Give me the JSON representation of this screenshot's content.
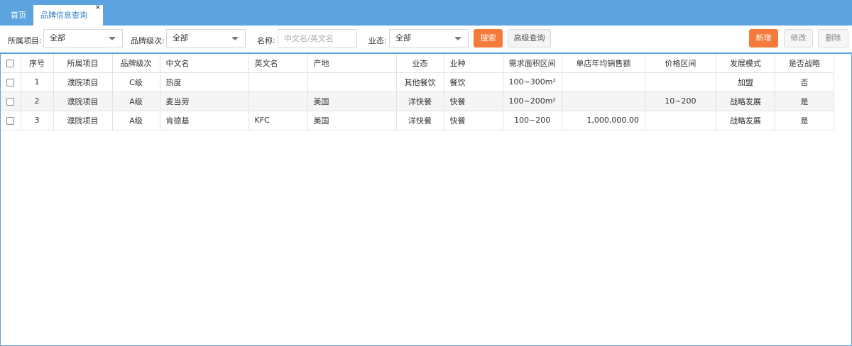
{
  "tabs": {
    "home": "首页",
    "active": "品牌信息查询",
    "close": "×"
  },
  "filters": {
    "project_label": "所属项目:",
    "project_value": "全部",
    "level_label": "品牌级次:",
    "level_value": "全部",
    "name_label": "名称:",
    "name_placeholder": "中文名/英文名",
    "format_label": "业态:",
    "format_value": "全部",
    "search_button": "搜索",
    "advanced_button": "高级查询"
  },
  "actions": {
    "add": "新增",
    "edit": "修改",
    "delete": "删除"
  },
  "colors": {
    "header_blue": "#5ca3e0",
    "accent_orange": "#f67b3b"
  },
  "table": {
    "headers": [
      "序号",
      "所属项目",
      "品牌级次",
      "中文名",
      "英文名",
      "产地",
      "业态",
      "业种",
      "需求面积区间",
      "单店年均销售额",
      "价格区间",
      "发展模式",
      "是否战略"
    ],
    "rows": [
      [
        "1",
        "濮院项目",
        "C级",
        "热度",
        "",
        "",
        "其他餐饮",
        "餐饮",
        "100~300m²",
        "",
        "",
        "加盟",
        "否"
      ],
      [
        "2",
        "濮院项目",
        "A级",
        "麦当劳",
        "",
        "美国",
        "洋快餐",
        "快餐",
        "100~200m²",
        "",
        "10~200",
        "战略发展",
        "是"
      ],
      [
        "3",
        "濮院项目",
        "A级",
        "肯德基",
        "KFC",
        "美国",
        "洋快餐",
        "快餐",
        "100~200",
        "1,000,000.00",
        "",
        "战略发展",
        "是"
      ]
    ]
  }
}
